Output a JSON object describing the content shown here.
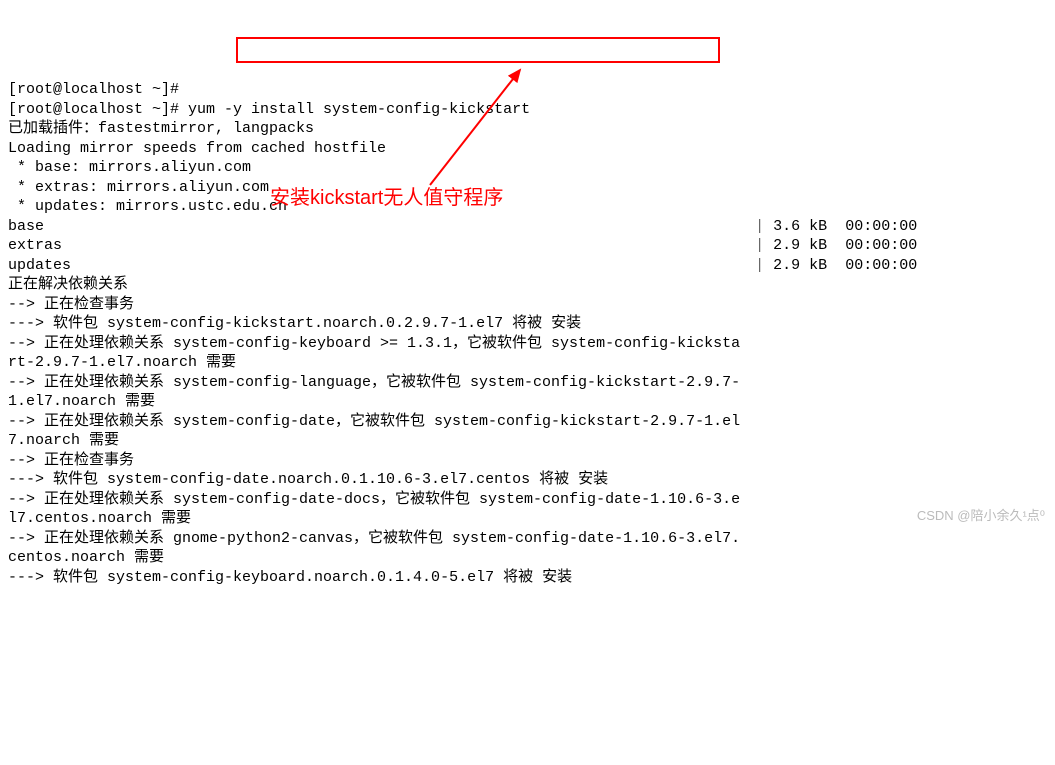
{
  "prompt1": "[root@localhost ~]# ",
  "prompt2": "[root@localhost ~]# ",
  "cmd": "yum -y install system-config-kickstart",
  "l1": "已加载插件：fastestmirror, langpacks",
  "l2": "Loading mirror speeds from cached hostfile",
  "l3": " * base: mirrors.aliyun.com",
  "l4": " * extras: mirrors.aliyun.com",
  "l5": " * updates: mirrors.ustc.edu.cn",
  "r1a": "base",
  "r1b": "3.6 kB",
  "r1c": "00:00:00",
  "r2a": "extras",
  "r2b": "2.9 kB",
  "r2c": "00:00:00",
  "r3a": "updates",
  "r3b": "2.9 kB",
  "r3c": "00:00:00",
  "l6": "正在解决依赖关系",
  "l7": "--> 正在检查事务",
  "l8": "---> 软件包 system-config-kickstart.noarch.0.2.9.7-1.el7 将被 安装",
  "l9": "--> 正在处理依赖关系 system-config-keyboard >= 1.3.1，它被软件包 system-config-kicksta\nrt-2.9.7-1.el7.noarch 需要",
  "l10": "--> 正在处理依赖关系 system-config-language，它被软件包 system-config-kickstart-2.9.7-\n1.el7.noarch 需要",
  "l11": "--> 正在处理依赖关系 system-config-date，它被软件包 system-config-kickstart-2.9.7-1.el\n7.noarch 需要",
  "l12": "--> 正在检查事务",
  "l13": "---> 软件包 system-config-date.noarch.0.1.10.6-3.el7.centos 将被 安装",
  "l14": "--> 正在处理依赖关系 system-config-date-docs，它被软件包 system-config-date-1.10.6-3.e\nl7.centos.noarch 需要",
  "l15": "--> 正在处理依赖关系 gnome-python2-canvas，它被软件包 system-config-date-1.10.6-3.el7.\ncentos.noarch 需要",
  "l16": "---> 软件包 system-config-keyboard.noarch.0.1.4.0-5.el7 将被 安装",
  "annot": "安装kickstart无人值守程序",
  "watermark": "CSDN @陪小余久¹点⁰"
}
